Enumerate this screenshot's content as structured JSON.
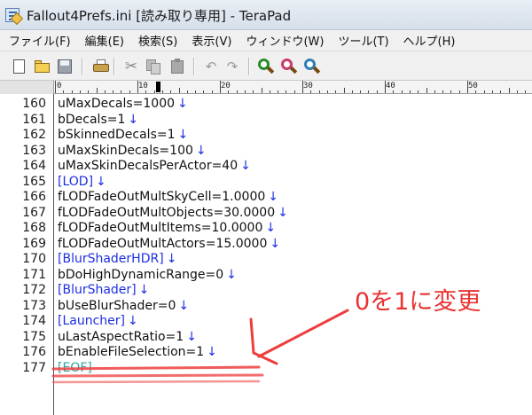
{
  "window": {
    "title": "Fallout4Prefs.ini [読み取り専用] - TeraPad"
  },
  "menu": [
    {
      "label": "ファイル(F)"
    },
    {
      "label": "編集(E)"
    },
    {
      "label": "検索(S)"
    },
    {
      "label": "表示(V)"
    },
    {
      "label": "ウィンドウ(W)"
    },
    {
      "label": "ツール(T)"
    },
    {
      "label": "ヘルプ(H)"
    }
  ],
  "toolbar": {
    "icons": [
      "new-file-icon",
      "open-folder-icon",
      "save-icon",
      "print-icon",
      "cut-icon",
      "copy-icon",
      "paste-icon",
      "undo-icon",
      "redo-icon",
      "find-icon",
      "find-next-icon",
      "find-previous-icon"
    ]
  },
  "ruler": {
    "labels": [
      "0",
      "10",
      "20",
      "30",
      "40",
      "50"
    ]
  },
  "editor": {
    "eol_mark": "↓",
    "lines": [
      {
        "num": "160",
        "text": "uMaxDecals=1000",
        "eol": true
      },
      {
        "num": "161",
        "text": "bDecals=1",
        "eol": true
      },
      {
        "num": "162",
        "text": "bSkinnedDecals=1",
        "eol": true
      },
      {
        "num": "163",
        "text": "uMaxSkinDecals=100",
        "eol": true
      },
      {
        "num": "164",
        "text": "uMaxSkinDecalsPerActor=40",
        "eol": true
      },
      {
        "num": "165",
        "text": "[LOD]",
        "eol": true,
        "kind": "section"
      },
      {
        "num": "166",
        "text": "fLODFadeOutMultSkyCell=1.0000",
        "eol": true
      },
      {
        "num": "167",
        "text": "fLODFadeOutMultObjects=30.0000",
        "eol": true
      },
      {
        "num": "168",
        "text": "fLODFadeOutMultItems=10.0000",
        "eol": true
      },
      {
        "num": "169",
        "text": "fLODFadeOutMultActors=15.0000",
        "eol": true
      },
      {
        "num": "170",
        "text": "[BlurShaderHDR]",
        "eol": true,
        "kind": "section"
      },
      {
        "num": "171",
        "text": "bDoHighDynamicRange=0",
        "eol": true
      },
      {
        "num": "172",
        "text": "[BlurShader]",
        "eol": true,
        "kind": "section"
      },
      {
        "num": "173",
        "text": "bUseBlurShader=0",
        "eol": true
      },
      {
        "num": "174",
        "text": "[Launcher]",
        "eol": true,
        "kind": "section"
      },
      {
        "num": "175",
        "text": "uLastAspectRatio=1",
        "eol": true
      },
      {
        "num": "176",
        "text": "bEnableFileSelection=1",
        "eol": true
      },
      {
        "num": "177",
        "text": "[EOF]",
        "eol": false,
        "kind": "eof"
      }
    ]
  },
  "annotation": {
    "text": "0を1に変更",
    "color": "#e83333"
  },
  "colors": {
    "section": "#1c2ee0",
    "eol_mark": "#1c2ee0",
    "eof": "#2aa7a7",
    "annotation": "#e83333"
  }
}
